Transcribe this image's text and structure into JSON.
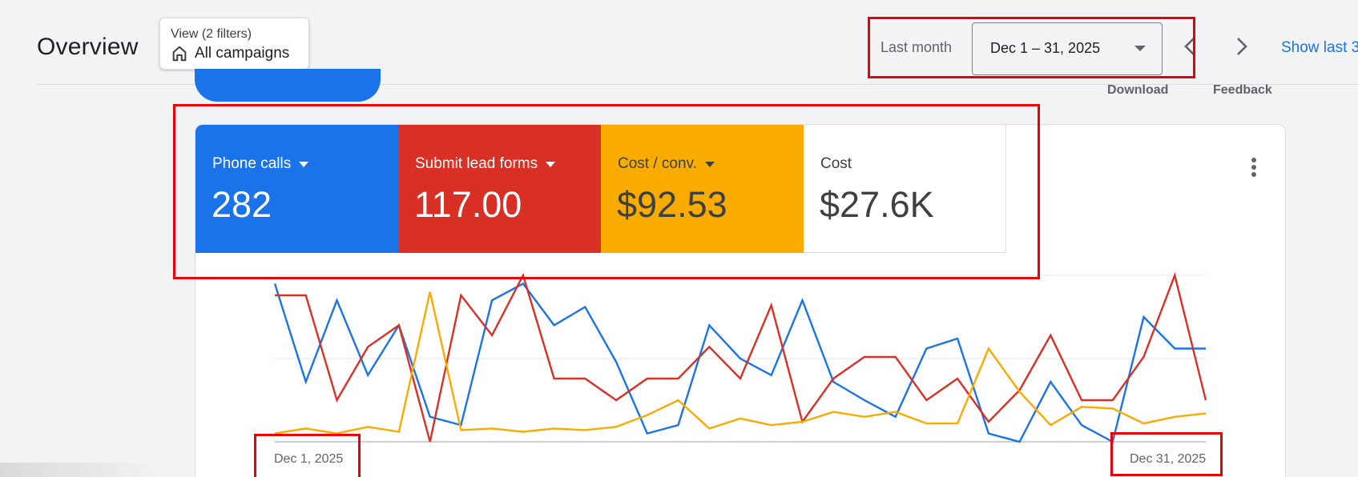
{
  "header": {
    "title": "Overview",
    "filter_chip": {
      "top": "View (2 filters)",
      "bottom": "All campaigns"
    },
    "date_label": "Last month",
    "date_range": "Dec 1 – 31, 2025",
    "show_last": "Show last 3",
    "actions": {
      "download": "Download",
      "feedback": "Feedback"
    }
  },
  "metrics": [
    {
      "label": "Phone calls",
      "value": "282",
      "color": "#1a73e8"
    },
    {
      "label": "Submit lead forms",
      "value": "117.00",
      "color": "#d93025"
    },
    {
      "label": "Cost / conv.",
      "value": "$92.53",
      "color": "#f9ab00"
    },
    {
      "label": "Cost",
      "value": "$27.6K",
      "color": "#ffffff"
    }
  ],
  "chart_data": {
    "type": "line",
    "x": [
      "Dec 1",
      "Dec 2",
      "Dec 3",
      "Dec 4",
      "Dec 5",
      "Dec 6",
      "Dec 7",
      "Dec 8",
      "Dec 9",
      "Dec 10",
      "Dec 11",
      "Dec 12",
      "Dec 13",
      "Dec 14",
      "Dec 15",
      "Dec 16",
      "Dec 17",
      "Dec 18",
      "Dec 19",
      "Dec 20",
      "Dec 21",
      "Dec 22",
      "Dec 23",
      "Dec 24",
      "Dec 25",
      "Dec 26",
      "Dec 27",
      "Dec 28",
      "Dec 29",
      "Dec 30",
      "Dec 31"
    ],
    "x_tick_labels": {
      "start": "Dec 1, 2025",
      "end": "Dec 31, 2025"
    },
    "ylim": [
      0,
      100
    ],
    "grid": true,
    "series": [
      {
        "color": "#1a73e8",
        "values": [
          95,
          36,
          85,
          40,
          70,
          15,
          10,
          85,
          95,
          70,
          81,
          48,
          5,
          10,
          70,
          50,
          40,
          85,
          36,
          25,
          15,
          56,
          62,
          5,
          0,
          36,
          10,
          0,
          75,
          56,
          56
        ]
      },
      {
        "color": "#d93025",
        "values": [
          88,
          88,
          25,
          57,
          70,
          0,
          88,
          64,
          100,
          38,
          38,
          25,
          38,
          38,
          57,
          38,
          82,
          12,
          38,
          51,
          51,
          25,
          38,
          12,
          31,
          64,
          25,
          25,
          51,
          100,
          25
        ]
      },
      {
        "color": "#f9ab00",
        "values": [
          5,
          8,
          5,
          9,
          6,
          90,
          7,
          8,
          6,
          8,
          7,
          9,
          16,
          25,
          8,
          14,
          10,
          12,
          18,
          15,
          18,
          11,
          11,
          56,
          30,
          10,
          21,
          20,
          11,
          15,
          17
        ]
      }
    ]
  }
}
